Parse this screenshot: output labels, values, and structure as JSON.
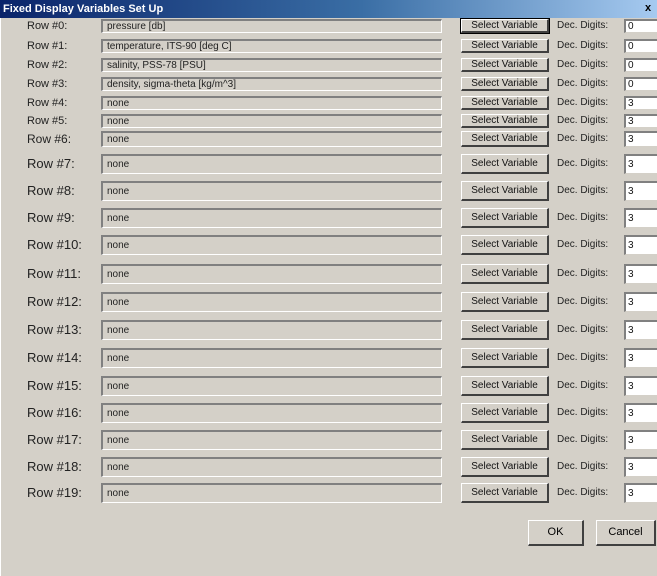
{
  "window": {
    "title": "Fixed Display Variables Set Up",
    "close_label": "x"
  },
  "rows": [
    {
      "label": "Row #0:",
      "variable": "pressure [db]",
      "button": "Select Variable",
      "dec_label": "Dec. Digits:",
      "dec_value": "0"
    },
    {
      "label": "Row #1:",
      "variable": "temperature, ITS-90 [deg C]",
      "button": "Select Variable",
      "dec_label": "Dec. Digits:",
      "dec_value": "0"
    },
    {
      "label": "Row #2:",
      "variable": "salinity, PSS-78 [PSU]",
      "button": "Select Variable",
      "dec_label": "Dec. Digits:",
      "dec_value": "0"
    },
    {
      "label": "Row #3:",
      "variable": "density, sigma-theta [kg/m^3]",
      "button": "Select Variable",
      "dec_label": "Dec. Digits:",
      "dec_value": "0"
    },
    {
      "label": "Row #4:",
      "variable": "none",
      "button": "Select Variable",
      "dec_label": "Dec. Digits:",
      "dec_value": "3"
    },
    {
      "label": "Row #5:",
      "variable": "none",
      "button": "Select Variable",
      "dec_label": "Dec. Digits:",
      "dec_value": "3"
    },
    {
      "label": "Row #6:",
      "variable": "none",
      "button": "Select Variable",
      "dec_label": "Dec. Digits:",
      "dec_value": "3"
    },
    {
      "label": "Row #7:",
      "variable": "none",
      "button": "Select Variable",
      "dec_label": "Dec. Digits:",
      "dec_value": "3"
    },
    {
      "label": "Row #8:",
      "variable": "none",
      "button": "Select Variable",
      "dec_label": "Dec. Digits:",
      "dec_value": "3"
    },
    {
      "label": "Row #9:",
      "variable": "none",
      "button": "Select Variable",
      "dec_label": "Dec. Digits:",
      "dec_value": "3"
    },
    {
      "label": "Row #10:",
      "variable": "none",
      "button": "Select Variable",
      "dec_label": "Dec. Digits:",
      "dec_value": "3"
    },
    {
      "label": "Row #11:",
      "variable": "none",
      "button": "Select Variable",
      "dec_label": "Dec. Digits:",
      "dec_value": "3"
    },
    {
      "label": "Row #12:",
      "variable": "none",
      "button": "Select Variable",
      "dec_label": "Dec. Digits:",
      "dec_value": "3"
    },
    {
      "label": "Row #13:",
      "variable": "none",
      "button": "Select Variable",
      "dec_label": "Dec. Digits:",
      "dec_value": "3"
    },
    {
      "label": "Row #14:",
      "variable": "none",
      "button": "Select Variable",
      "dec_label": "Dec. Digits:",
      "dec_value": "3"
    },
    {
      "label": "Row #15:",
      "variable": "none",
      "button": "Select Variable",
      "dec_label": "Dec. Digits:",
      "dec_value": "3"
    },
    {
      "label": "Row #16:",
      "variable": "none",
      "button": "Select Variable",
      "dec_label": "Dec. Digits:",
      "dec_value": "3"
    },
    {
      "label": "Row #17:",
      "variable": "none",
      "button": "Select Variable",
      "dec_label": "Dec. Digits:",
      "dec_value": "3"
    },
    {
      "label": "Row #18:",
      "variable": "none",
      "button": "Select Variable",
      "dec_label": "Dec. Digits:",
      "dec_value": "3"
    },
    {
      "label": "Row #19:",
      "variable": "none",
      "button": "Select Variable",
      "dec_label": "Dec. Digits:",
      "dec_value": "3"
    }
  ],
  "buttons": {
    "ok_label": "OK",
    "cancel_label": "Cancel"
  }
}
